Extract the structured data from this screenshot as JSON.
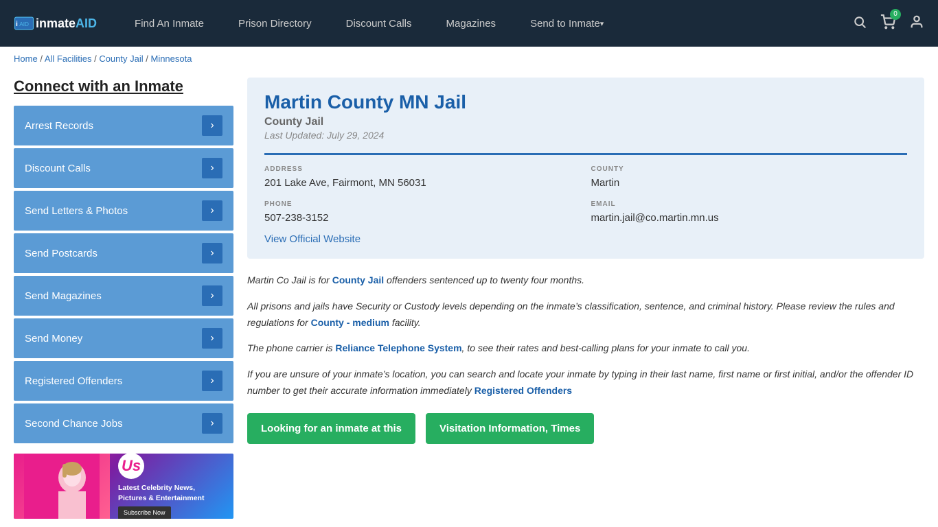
{
  "header": {
    "logo_inmate": "inmate",
    "logo_aid": "AID",
    "nav_items": [
      {
        "label": "Find An Inmate",
        "dropdown": false
      },
      {
        "label": "Prison Directory",
        "dropdown": false
      },
      {
        "label": "Discount Calls",
        "dropdown": false
      },
      {
        "label": "Magazines",
        "dropdown": false
      },
      {
        "label": "Send to Inmate",
        "dropdown": true
      }
    ],
    "cart_count": "0"
  },
  "breadcrumb": {
    "home": "Home",
    "separator1": " / ",
    "all_facilities": "All Facilities",
    "separator2": " / ",
    "county_jail": "County Jail",
    "separator3": " / ",
    "minnesota": "Minnesota"
  },
  "sidebar": {
    "title": "Connect with an Inmate",
    "items": [
      {
        "label": "Arrest Records"
      },
      {
        "label": "Discount Calls"
      },
      {
        "label": "Send Letters & Photos"
      },
      {
        "label": "Send Postcards"
      },
      {
        "label": "Send Magazines"
      },
      {
        "label": "Send Money"
      },
      {
        "label": "Registered Offenders"
      },
      {
        "label": "Second Chance Jobs"
      }
    ]
  },
  "ad": {
    "headline": "Latest Celebrity News, Pictures & Entertainment",
    "subscribe": "Subscribe Now",
    "logo": "Us"
  },
  "facility": {
    "name": "Martin County MN Jail",
    "type": "County Jail",
    "last_updated": "Last Updated: July 29, 2024",
    "address_label": "ADDRESS",
    "address_value": "201 Lake Ave, Fairmont, MN 56031",
    "county_label": "COUNTY",
    "county_value": "Martin",
    "phone_label": "PHONE",
    "phone_value": "507-238-3152",
    "email_label": "EMAIL",
    "email_value": "martin.jail@co.martin.mn.us",
    "website_link": "View Official Website"
  },
  "description": {
    "p1_before": "Martin Co Jail is for ",
    "p1_link": "County Jail",
    "p1_after": " offenders sentenced up to twenty four months.",
    "p2_before": "All prisons and jails have Security or Custody levels depending on the inmate’s classification, sentence, and criminal history. Please review the rules and regulations for ",
    "p2_link": "County - medium",
    "p2_after": " facility.",
    "p3_before": "The phone carrier is ",
    "p3_link": "Reliance Telephone System",
    "p3_after": ", to see their rates and best-calling plans for your inmate to call you.",
    "p4": "If you are unsure of your inmate’s location, you can search and locate your inmate by typing in their last name, first name or first initial, and/or the offender ID number to get their accurate information immediately",
    "p4_link": "Registered Offenders"
  },
  "buttons": {
    "looking": "Looking for an inmate at this",
    "visitation": "Visitation Information, Times"
  }
}
